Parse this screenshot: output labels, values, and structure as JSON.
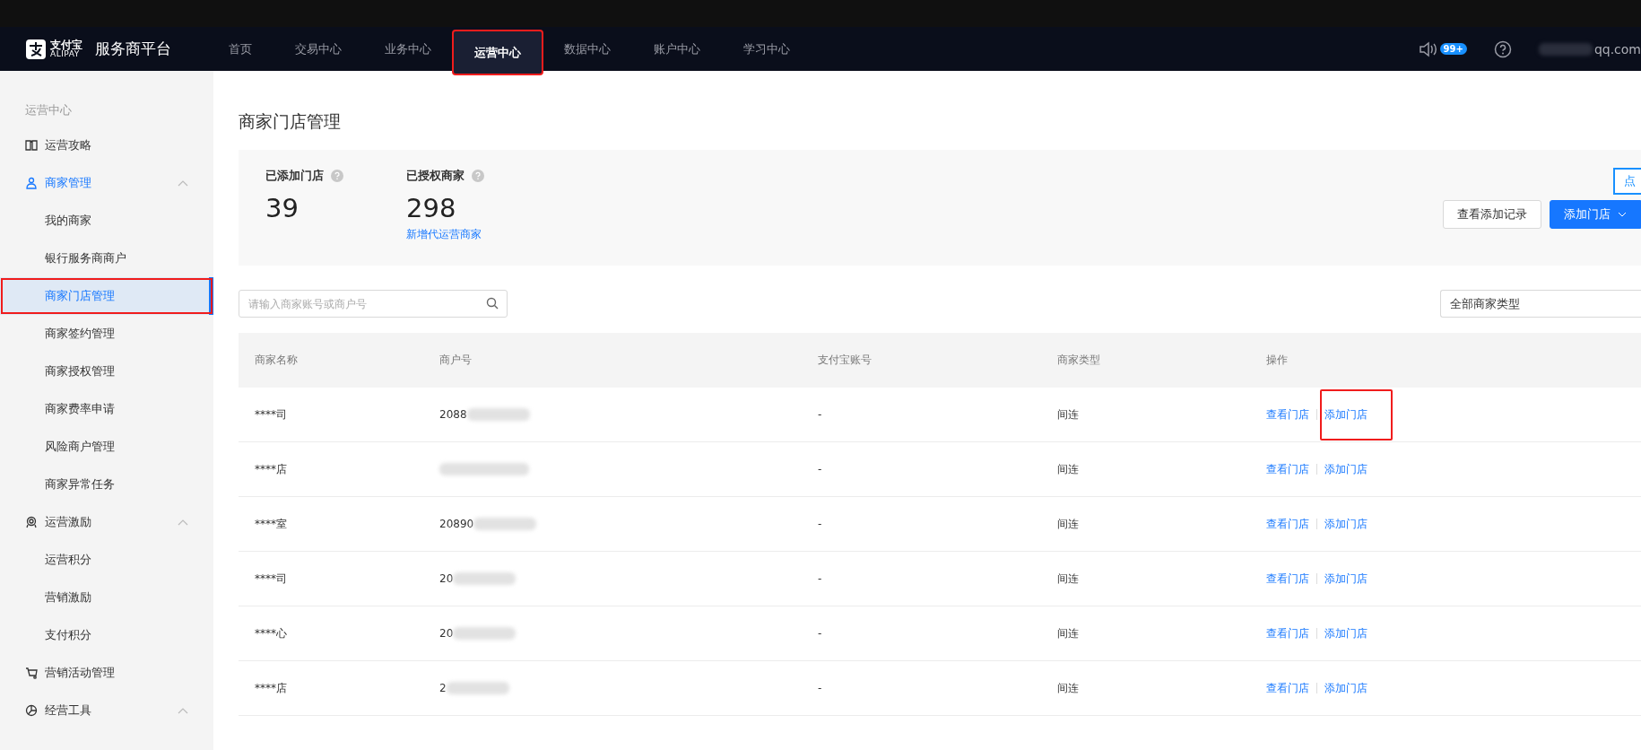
{
  "header": {
    "logo_text": "支付宝",
    "logo_subtext": "ALIPAY",
    "title": "服务商平台",
    "nav": [
      {
        "label": "首页",
        "selected": false,
        "highlighted": false
      },
      {
        "label": "交易中心",
        "selected": false,
        "highlighted": false
      },
      {
        "label": "业务中心",
        "selected": false,
        "highlighted": false
      },
      {
        "label": "运营中心",
        "selected": true,
        "highlighted": true
      },
      {
        "label": "数据中心",
        "selected": false,
        "highlighted": false
      },
      {
        "label": "账户中心",
        "selected": false,
        "highlighted": false
      },
      {
        "label": "学习中心",
        "selected": false,
        "highlighted": false
      }
    ],
    "notification_badge": "99+",
    "account": "qq.com"
  },
  "sidebar": {
    "heading": "运营中心",
    "items": [
      {
        "label": "运营攻略",
        "kind": "guide",
        "selected": false
      },
      {
        "label": "商家管理",
        "kind": "merchant",
        "expanded": true,
        "selected": true,
        "children": [
          {
            "label": "我的商家",
            "selected": false,
            "highlighted": false
          },
          {
            "label": "银行服务商商户",
            "selected": false,
            "highlighted": false
          },
          {
            "label": "商家门店管理",
            "selected": true,
            "highlighted": true
          },
          {
            "label": "商家签约管理",
            "selected": false,
            "highlighted": false
          },
          {
            "label": "商家授权管理",
            "selected": false,
            "highlighted": false
          },
          {
            "label": "商家费率申请",
            "selected": false,
            "highlighted": false
          },
          {
            "label": "风险商户管理",
            "selected": false,
            "highlighted": false
          },
          {
            "label": "商家异常任务",
            "selected": false,
            "highlighted": false
          }
        ]
      },
      {
        "label": "运营激励",
        "kind": "reward",
        "expanded": true,
        "selected": false,
        "children": [
          {
            "label": "运营积分",
            "selected": false,
            "highlighted": false
          },
          {
            "label": "营销激励",
            "selected": false,
            "highlighted": false
          },
          {
            "label": "支付积分",
            "selected": false,
            "highlighted": false
          }
        ]
      },
      {
        "label": "营销活动管理",
        "kind": "cart",
        "selected": false
      },
      {
        "label": "经营工具",
        "kind": "chart",
        "expanded": true,
        "selected": false
      }
    ]
  },
  "page": {
    "title": "商家门店管理",
    "stats": [
      {
        "label": "已添加门店",
        "value": "39"
      },
      {
        "label": "已授权商家",
        "value": "298",
        "link": "新增代运营商家"
      }
    ],
    "tooltip": "点",
    "buttons": [
      {
        "label": "查看添加记录",
        "kind": "default"
      },
      {
        "label": "添加门店",
        "kind": "primary"
      }
    ],
    "search": {
      "placeholder": "请输入商家账号或商户号"
    },
    "type_filter": {
      "value": "全部商家类型"
    },
    "table": {
      "columns": [
        "商家名称",
        "商户号",
        "支付宝账号",
        "商家类型",
        "操作"
      ],
      "rows": [
        {
          "name": "****司",
          "merchant_no": "2088",
          "alipay_account": "-",
          "type": "间连",
          "actions": [
            {
              "label": "查看门店",
              "highlighted": false
            },
            {
              "label": "添加门店",
              "highlighted": true
            }
          ]
        },
        {
          "name": "****店",
          "alipay_account": "-",
          "type": "间连",
          "actions": [
            {
              "label": "查看门店",
              "highlighted": false
            },
            {
              "label": "添加门店",
              "highlighted": false
            }
          ]
        },
        {
          "name": "****室",
          "merchant_no": "20890",
          "alipay_account": "-",
          "type": "间连",
          "actions": [
            {
              "label": "查看门店",
              "highlighted": false
            },
            {
              "label": "添加门店",
              "highlighted": false
            }
          ]
        },
        {
          "name": "****司",
          "merchant_no": "20",
          "alipay_account": "-",
          "type": "间连",
          "actions": [
            {
              "label": "查看门店",
              "highlighted": false
            },
            {
              "label": "添加门店",
              "highlighted": false
            }
          ]
        },
        {
          "name": "****心",
          "merchant_no": "20",
          "alipay_account": "-",
          "type": "间连",
          "actions": [
            {
              "label": "查看门店",
              "highlighted": false
            },
            {
              "label": "添加门店",
              "highlighted": false
            }
          ]
        },
        {
          "name": "****店",
          "merchant_no": "2",
          "alipay_account": "-",
          "type": "间连",
          "actions": [
            {
              "label": "查看门店",
              "highlighted": false
            },
            {
              "label": "添加门店",
              "highlighted": false
            }
          ]
        }
      ]
    }
  }
}
